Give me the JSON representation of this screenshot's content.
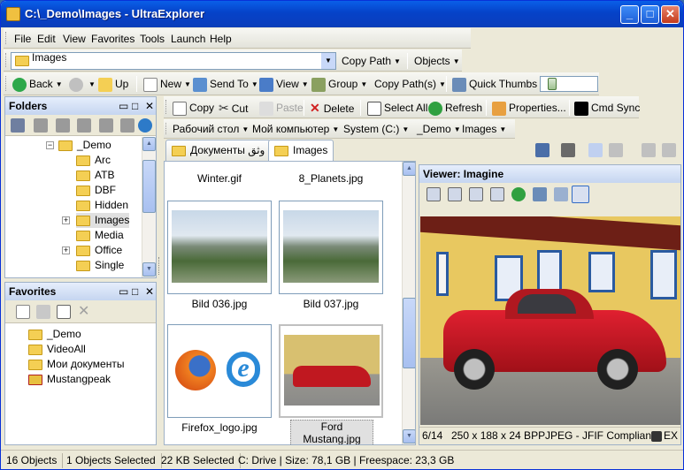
{
  "window": {
    "title": "C:\\_Demo\\Images - UltraExplorer",
    "buttons": [
      "_",
      "□",
      "✕"
    ]
  },
  "menu": [
    "File",
    "Edit",
    "View",
    "Favorites",
    "Tools",
    "Launch",
    "Help"
  ],
  "address": {
    "value": "Images",
    "copy_path": "Copy Path",
    "objects": "Objects"
  },
  "navbar": {
    "back": "Back",
    "up": "Up",
    "new": "New",
    "send_to": "Send To",
    "view": "View",
    "group": "Group",
    "copy_paths": "Copy Path(s)",
    "quick_thumbs": "Quick Thumbs"
  },
  "folders": {
    "title": "Folders",
    "items": [
      "_Demo",
      "Arc",
      "ATB",
      "DBF",
      "Hidden",
      "Images",
      "Media",
      "Office",
      "Single"
    ]
  },
  "favorites": {
    "title": "Favorites",
    "items": [
      "_Demo",
      "VideoAll",
      "Мои документы",
      "Mustangpeak"
    ]
  },
  "actions": {
    "copy": "Copy",
    "cut": "Cut",
    "paste": "Paste",
    "delete": "Delete",
    "select_all": "Select All",
    "refresh": "Refresh",
    "properties": "Properties...",
    "cmd_sync": "Cmd Sync"
  },
  "breadcrumb": [
    "Рабочий стол",
    "Мой компьютер",
    "System (C:)",
    "_Demo",
    "Images"
  ],
  "tabs": [
    "Документы وثق",
    "Images"
  ],
  "thumbs": {
    "top": [
      "Winter.gif",
      "8_Planets.jpg"
    ],
    "row1": [
      "Bild 036.jpg",
      "Bild 037.jpg"
    ],
    "row2": [
      "Firefox_logo.jpg",
      "Ford Mustang.jpg"
    ]
  },
  "viewer": {
    "title": "Viewer: Imagine",
    "index": "6/14",
    "dims": "250 x 188 x 24 BPP",
    "format": "JPEG - JFIF Compliant",
    "exif": "EX"
  },
  "status": {
    "objects": "16 Objects",
    "selected": "1 Objects Selected",
    "kb": "22 KB Selected",
    "drive": "C: Drive | Size: 78,1 GB | Freespace: 23,3 GB"
  }
}
